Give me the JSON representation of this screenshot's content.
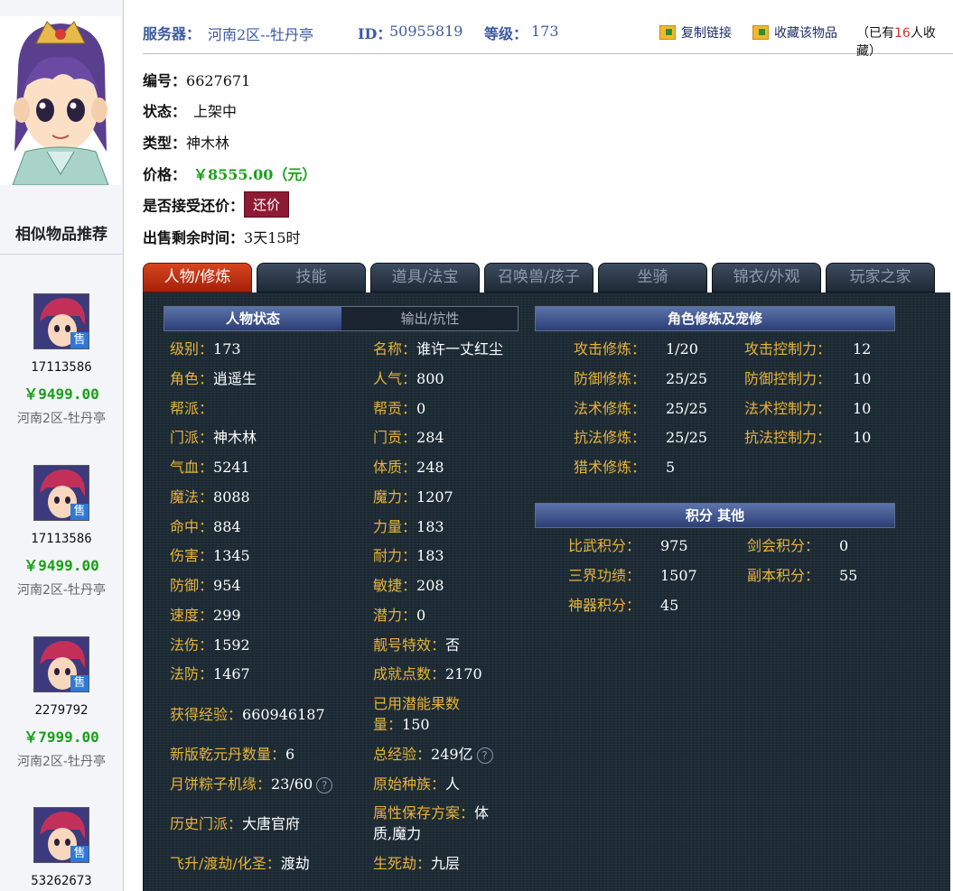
{
  "header": {
    "server_label": "服务器：",
    "server_value": "河南2区--牡丹亭",
    "id_label": "ID：",
    "id_value": "50955819",
    "level_label": "等级：",
    "level_value": "173",
    "copy_link": "复制链接",
    "favorite": "收藏该物品",
    "fav_prefix": "（已有",
    "fav_count": "16",
    "fav_suffix": "人收藏）"
  },
  "info": {
    "number_label": "编号：",
    "number_value": "6627671",
    "status_label": "状态：",
    "status_value": "上架中",
    "type_label": "类型：",
    "type_value": "神木林",
    "price_label": "价格：",
    "price_value": "￥8555.00（元）",
    "bargain_label": "是否接受还价：",
    "bargain_button": "还价",
    "remaining_label": "出售剩余时间：",
    "remaining_value": "3天15时"
  },
  "sidebar": {
    "title": "相似物品推荐",
    "items": [
      {
        "id": "17113586",
        "price": "￥9499.00",
        "server": "河南2区-牡丹亭",
        "badge": "售"
      },
      {
        "id": "17113586",
        "price": "￥9499.00",
        "server": "河南2区-牡丹亭",
        "badge": "售"
      },
      {
        "id": "2279792",
        "price": "￥7999.00",
        "server": "河南2区-牡丹亭",
        "badge": "售"
      },
      {
        "id": "53262673",
        "price": "",
        "server": "",
        "badge": "售"
      }
    ]
  },
  "tabs": [
    "人物/修炼",
    "技能",
    "道具/法宝",
    "召唤兽/孩子",
    "坐骑",
    "锦衣/外观",
    "玩家之家"
  ],
  "active_tab": "人物/修炼",
  "subtabs": {
    "a": "人物状态",
    "b": "输出/抗性"
  },
  "sections": {
    "cultivation": "角色修炼及宠修",
    "score": "积分  其他"
  },
  "stats_left": [
    {
      "k": "级别：",
      "v": "173"
    },
    {
      "k": "角色：",
      "v": "逍遥生"
    },
    {
      "k": "帮派：",
      "v": ""
    },
    {
      "k": "门派：",
      "v": "神木林"
    },
    {
      "k": "气血：",
      "v": "5241"
    },
    {
      "k": "魔法：",
      "v": "8088"
    },
    {
      "k": "命中：",
      "v": "884"
    },
    {
      "k": "伤害：",
      "v": "1345"
    },
    {
      "k": "防御：",
      "v": "954"
    },
    {
      "k": "速度：",
      "v": "299"
    },
    {
      "k": "法伤：",
      "v": "1592"
    },
    {
      "k": "法防：",
      "v": "1467"
    },
    {
      "k": "获得经验：",
      "v": "660946187"
    },
    {
      "k": "新版乾元丹数量：",
      "v": "6"
    },
    {
      "k": "月饼粽子机缘：",
      "v": "23/60"
    },
    {
      "k": "历史门派：",
      "v": "大唐官府"
    },
    {
      "k": "飞升/渡劫/化圣：",
      "v": "渡劫"
    }
  ],
  "stats_mid": [
    {
      "k": "名称：",
      "v": "谁许一丈红尘"
    },
    {
      "k": "人气：",
      "v": "800"
    },
    {
      "k": "帮贡：",
      "v": "0"
    },
    {
      "k": "门贡：",
      "v": "284"
    },
    {
      "k": "体质：",
      "v": "248"
    },
    {
      "k": "魔力：",
      "v": "1207"
    },
    {
      "k": "力量：",
      "v": "183"
    },
    {
      "k": "耐力：",
      "v": "183"
    },
    {
      "k": "敏捷：",
      "v": "208"
    },
    {
      "k": "潜力：",
      "v": "0"
    },
    {
      "k": "靓号特效：",
      "v": "否"
    },
    {
      "k": "成就点数：",
      "v": "2170"
    },
    {
      "k": "已用潜能果数",
      "k2": "量：",
      "v": "150"
    },
    {
      "k": "总经验：",
      "v": "249亿"
    },
    {
      "k": "原始种族：",
      "v": "人"
    },
    {
      "k": "属性保存方案：",
      "v": "体",
      "v2": "质,魔力"
    },
    {
      "k": "生死劫：",
      "v": "九层"
    }
  ],
  "cultivation": [
    {
      "k": "攻击修炼：",
      "v": "1/20",
      "k2": "攻击控制力：",
      "v2": "12"
    },
    {
      "k": "防御修炼：",
      "v": "25/25",
      "k2": "防御控制力：",
      "v2": "10"
    },
    {
      "k": "法术修炼：",
      "v": "25/25",
      "k2": "法术控制力：",
      "v2": "10"
    },
    {
      "k": "抗法修炼：",
      "v": "25/25",
      "k2": "抗法控制力：",
      "v2": "10"
    },
    {
      "k": "猎术修炼：",
      "v": "5",
      "k2": "",
      "v2": ""
    }
  ],
  "scores": [
    {
      "k": "比武积分：",
      "v": "975",
      "k2": "剑会积分：",
      "v2": "0"
    },
    {
      "k": "三界功绩：",
      "v": "1507",
      "k2": "副本积分：",
      "v2": "55"
    },
    {
      "k": "神器积分：",
      "v": "45",
      "k2": "",
      "v2": ""
    }
  ],
  "help_glyph": "?"
}
